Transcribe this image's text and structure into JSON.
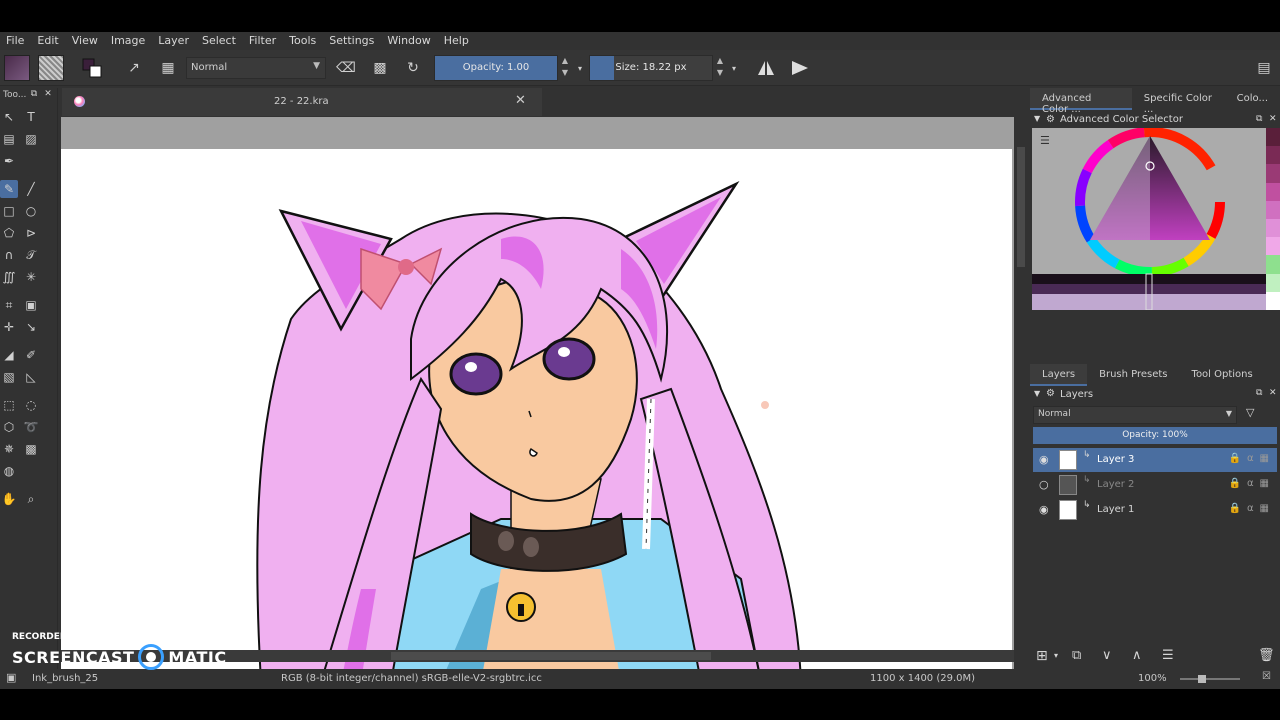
{
  "menu": [
    "File",
    "Edit",
    "View",
    "Image",
    "Layer",
    "Select",
    "Filter",
    "Tools",
    "Settings",
    "Window",
    "Help"
  ],
  "toolbar": {
    "blend_mode": "Normal",
    "opacity_label": "Opacity:  1.00",
    "opacity_value": 1.0,
    "size_label": "Size:  18.22 px",
    "size_fill_fraction": 0.2
  },
  "toolbox": {
    "title": "Too..."
  },
  "document": {
    "tab_title": "22 - 22.kra"
  },
  "right_panel": {
    "tabs": [
      "Advanced Color ...",
      "Specific Color ...",
      "Colo..."
    ],
    "color_dock_title": "Advanced Color Selector",
    "layer_tabs": [
      "Layers",
      "Brush Presets",
      "Tool Options"
    ],
    "layers_title": "Layers",
    "layer_blend": "Normal",
    "layer_opacity": "Opacity:  100%",
    "layers": [
      {
        "name": "Layer 3",
        "active": true,
        "visible": true
      },
      {
        "name": "Layer 2",
        "active": false,
        "visible": false
      },
      {
        "name": "Layer 1",
        "active": false,
        "visible": true
      }
    ],
    "palette": [
      "#5a1f3a",
      "#7a2a55",
      "#9a3a75",
      "#c050a0",
      "#d070c0",
      "#e090d8",
      "#f0a8e8",
      "#8ee08e",
      "#c0f0c0",
      "#ffffff"
    ]
  },
  "status": {
    "brush": "Ink_brush_25",
    "color_model": "RGB (8-bit integer/channel)  sRGB-elle-V2-srgbtrc.icc",
    "dimensions": "1100 x 1400 (29.0M)",
    "zoom": "100%"
  },
  "watermark": {
    "recorded": "RECORDED WITH",
    "brand_left": "SCREENCAST",
    "brand_right": "MATIC"
  },
  "colors": {
    "accent": "#4a6ea0",
    "hair": "#f0b0f0",
    "hair_shadow": "#e070e8",
    "skin": "#f9c9a0",
    "jacket": "#8fd8f5",
    "collar": "#3a2e2a"
  }
}
